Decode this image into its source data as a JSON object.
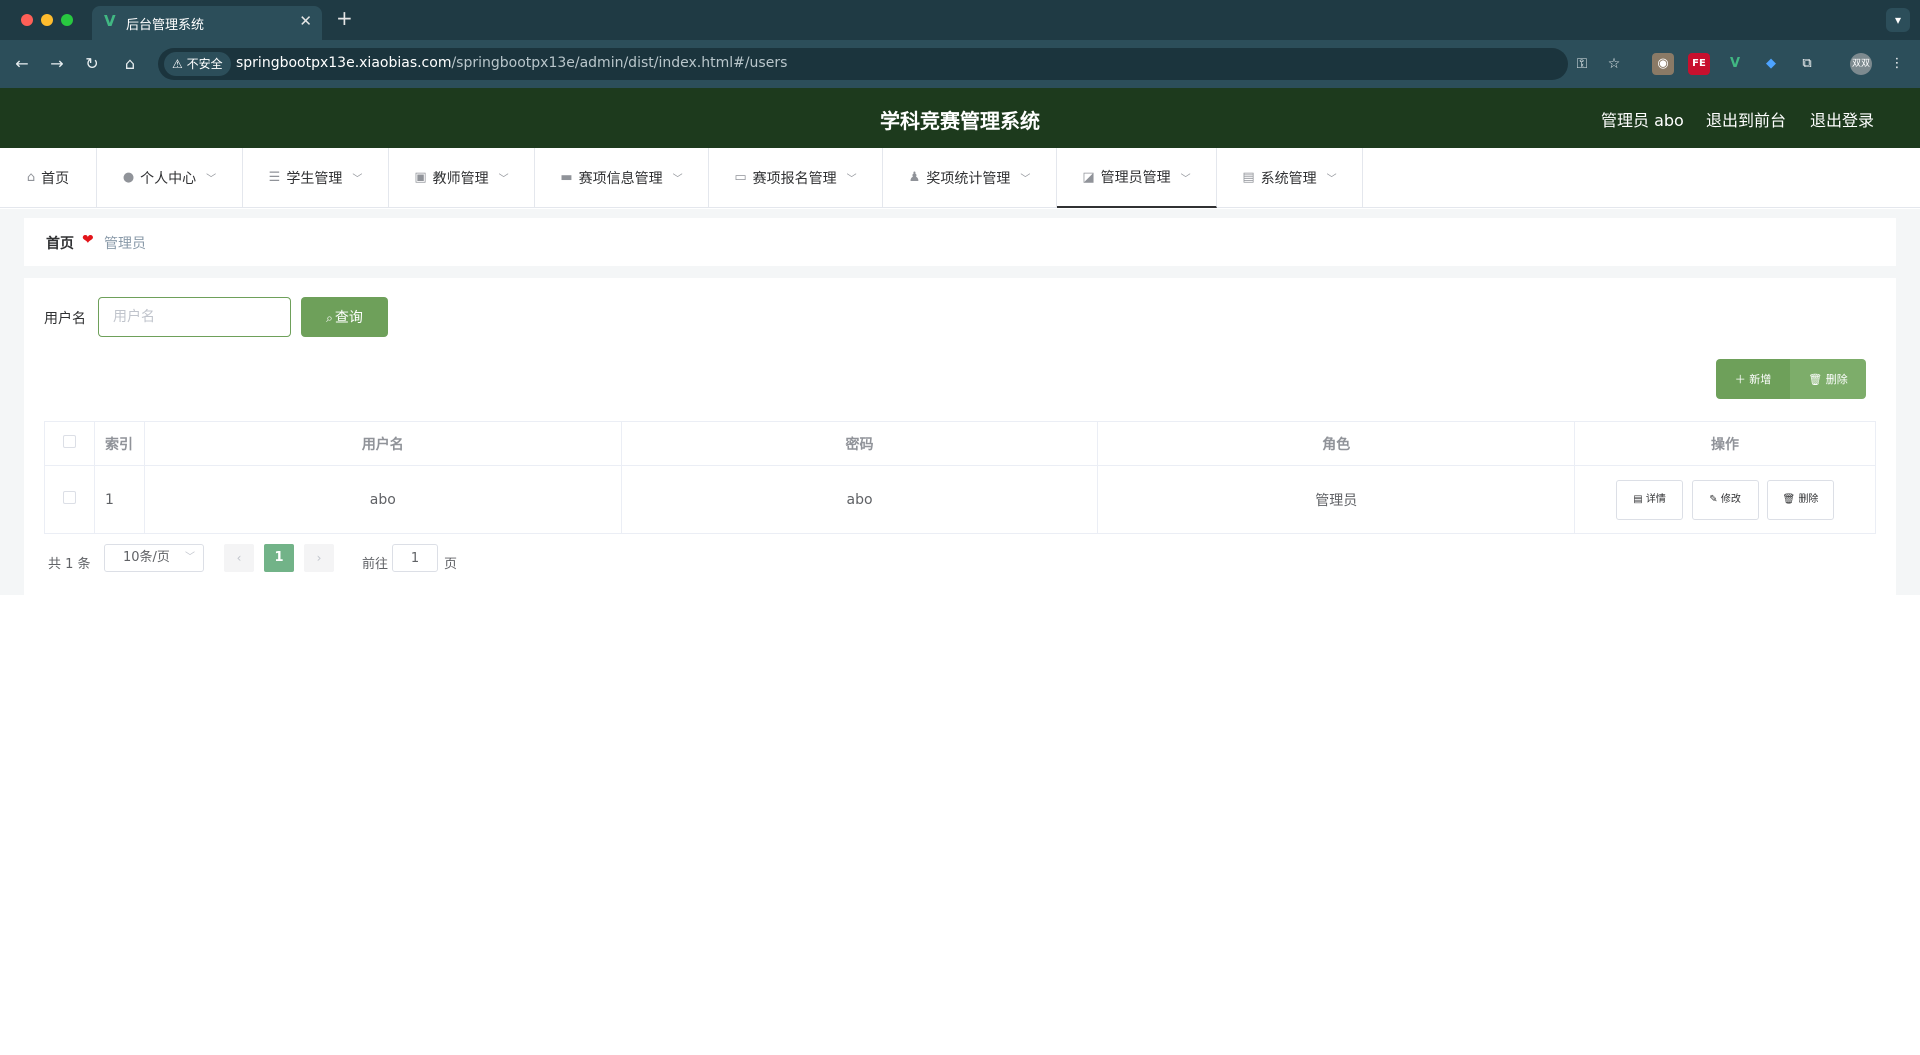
{
  "browser": {
    "tab_title": "后台管理系统",
    "security_label": "不安全",
    "url_host": "springbootpx13e.xiaobias.com",
    "url_path": "/springbootpx13e/admin/dist/index.html#/users",
    "profile_label": "双双"
  },
  "header": {
    "title": "学科竞赛管理系统",
    "user": "管理员 abo",
    "to_front": "退出到前台",
    "logout": "退出登录"
  },
  "menu": [
    {
      "label": "首页",
      "icon": "home-icon",
      "has_caret": false
    },
    {
      "label": "个人中心",
      "icon": "user-icon",
      "has_caret": true
    },
    {
      "label": "学生管理",
      "icon": "list-icon",
      "has_caret": true
    },
    {
      "label": "教师管理",
      "icon": "clipboard-icon",
      "has_caret": true
    },
    {
      "label": "赛项信息管理",
      "icon": "monitor-icon",
      "has_caret": true
    },
    {
      "label": "赛项报名管理",
      "icon": "card-icon",
      "has_caret": true
    },
    {
      "label": "奖项统计管理",
      "icon": "person-icon",
      "has_caret": true
    },
    {
      "label": "管理员管理",
      "icon": "chart-icon",
      "has_caret": true,
      "active": true
    },
    {
      "label": "系统管理",
      "icon": "briefcase-icon",
      "has_caret": true
    }
  ],
  "breadcrumb": {
    "home": "首页",
    "current": "管理员"
  },
  "search": {
    "label": "用户名",
    "placeholder": "用户名",
    "button": "查询"
  },
  "actions": {
    "add": "新增",
    "delete": "删除"
  },
  "table": {
    "headers": [
      "索引",
      "用户名",
      "密码",
      "角色",
      "操作"
    ],
    "rows": [
      {
        "index": "1",
        "username": "abo",
        "password": "abo",
        "role": "管理员"
      }
    ],
    "row_actions": {
      "detail": "详情",
      "edit": "修改",
      "delete": "删除"
    }
  },
  "pagination": {
    "total": "共 1 条",
    "page_size": "10条/页",
    "current_page": "1",
    "goto_label": "前往",
    "goto_value": "1",
    "page_suffix": "页"
  },
  "colors": {
    "header_bg": "#1d3a1d",
    "accent": "#6ea05a",
    "active_page": "#72b388"
  }
}
